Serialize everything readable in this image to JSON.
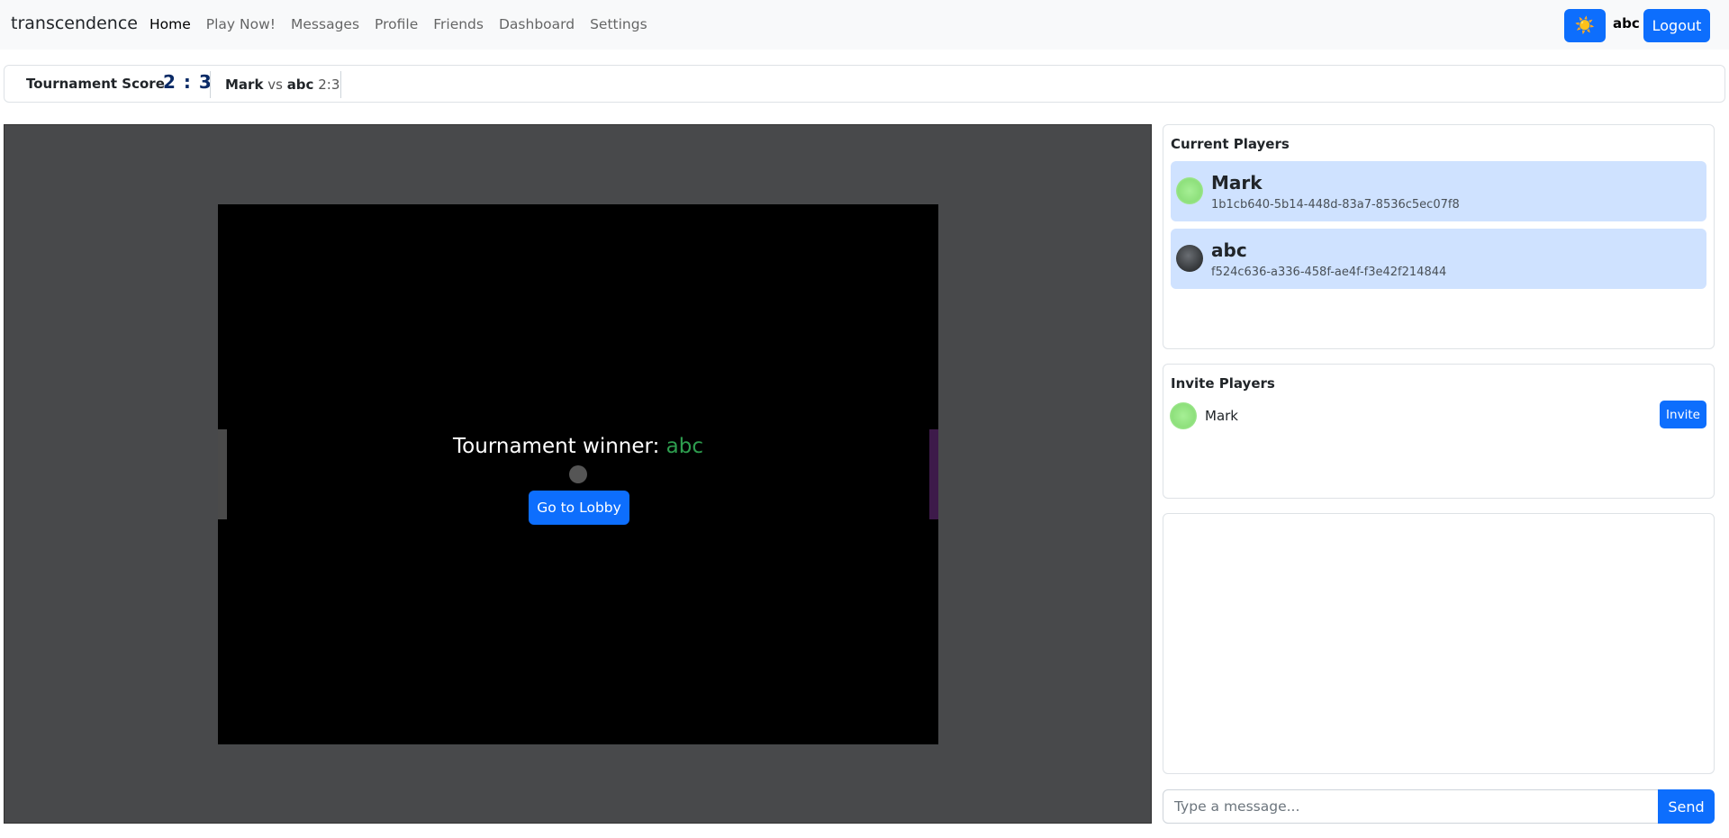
{
  "navbar": {
    "brand": "transcendence",
    "links": [
      "Home",
      "Play Now!",
      "Messages",
      "Profile",
      "Friends",
      "Dashboard",
      "Settings"
    ],
    "theme_icon": "sun-icon",
    "theme_glyph": "☀️",
    "username": "abc",
    "logout_label": "Logout"
  },
  "scorebar": {
    "label": "Tournament Score",
    "score": "2 : 3",
    "match": {
      "player1": "Mark",
      "vs": "vs",
      "player2": "abc",
      "score": "2:3"
    }
  },
  "game": {
    "winner_label": "Tournament winner: ",
    "winner_name": "abc",
    "lobby_button": "Go to Lobby",
    "colors": {
      "winner": "#2e9e4f",
      "left_paddle": "#4a4a4a",
      "right_paddle": "#3d1a4a",
      "canvas": "#000000"
    }
  },
  "current_players": {
    "title": "Current Players",
    "players": [
      {
        "name": "Mark",
        "id": "1b1cb640-5b14-448d-83a7-8536c5ec07f8"
      },
      {
        "name": "abc",
        "id": "f524c636-a336-458f-ae4f-f3e42f214844"
      }
    ]
  },
  "invite_players": {
    "title": "Invite Players",
    "players": [
      {
        "name": "Mark",
        "button": "Invite"
      }
    ]
  },
  "chat": {
    "placeholder": "Type a message...",
    "send_label": "Send"
  }
}
